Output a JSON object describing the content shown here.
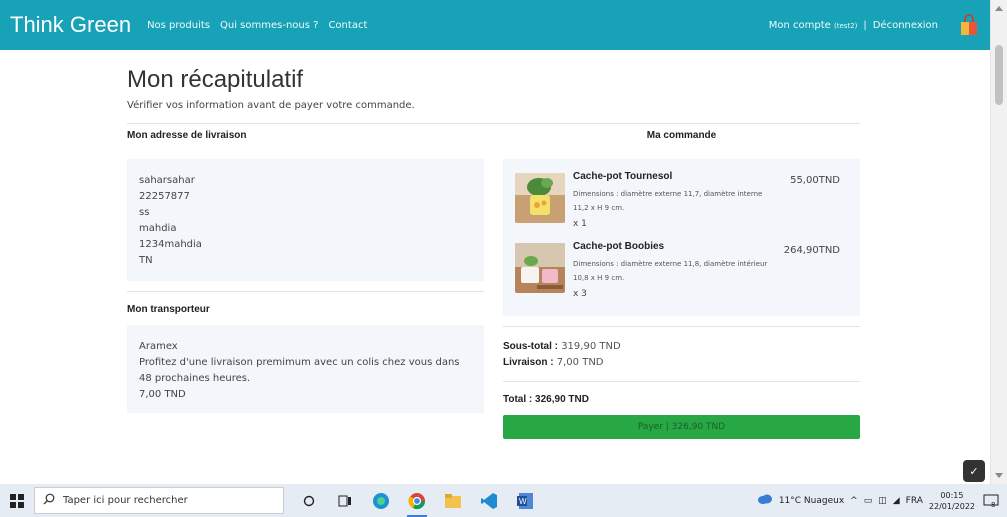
{
  "navbar": {
    "brand": "Think Green",
    "links": [
      "Nos produits",
      "Qui sommes-nous ?",
      "Contact"
    ],
    "account": "Mon compte",
    "account_user": "(test2)",
    "separator": "|",
    "logout": "Déconnexion"
  },
  "page": {
    "title": "Mon récapitulatif",
    "subtitle": "Vérifier vos information avant de payer votre commande."
  },
  "address": {
    "title": "Mon adresse de livraison",
    "lines": [
      "saharsahar",
      "22257877",
      "ss",
      "mahdia",
      "1234mahdia",
      "TN"
    ]
  },
  "carrier": {
    "title": "Mon transporteur",
    "name": "Aramex",
    "description_1": "Profitez d'une livraison premimum avec un colis chez vous dans",
    "description_2": "48 prochaines heures.",
    "price": "7,00 TND"
  },
  "order": {
    "title": "Ma commande",
    "products": [
      {
        "name": "Cache-pot Tournesol",
        "desc_1": "Dimensions : diamètre externe 11,7, diamètre interne",
        "desc_2": "11,2 x H 9 cm.",
        "qty": "x 1",
        "price": "55,00TND"
      },
      {
        "name": "Cache-pot Boobies",
        "desc_1": "Dimensions : diamètre externe 11,8, diamètre intérieur",
        "desc_2": "10,8 x H 9 cm.",
        "qty": "x 3",
        "price": "264,90TND"
      }
    ],
    "subtotal_label": "Sous-total :",
    "subtotal_value": "319,90 TND",
    "shipping_label": "Livraison :",
    "shipping_value": "7,00 TND",
    "total_label": "Total :",
    "total_value": "326,90 TND",
    "pay_button": "Payer | 326,90 TND"
  },
  "taskbar": {
    "search_placeholder": "Taper ici pour rechercher",
    "weather": "11°C Nuageux",
    "language": "FRA",
    "time": "00:15",
    "date": "22/01/2022",
    "notifications": "8"
  }
}
